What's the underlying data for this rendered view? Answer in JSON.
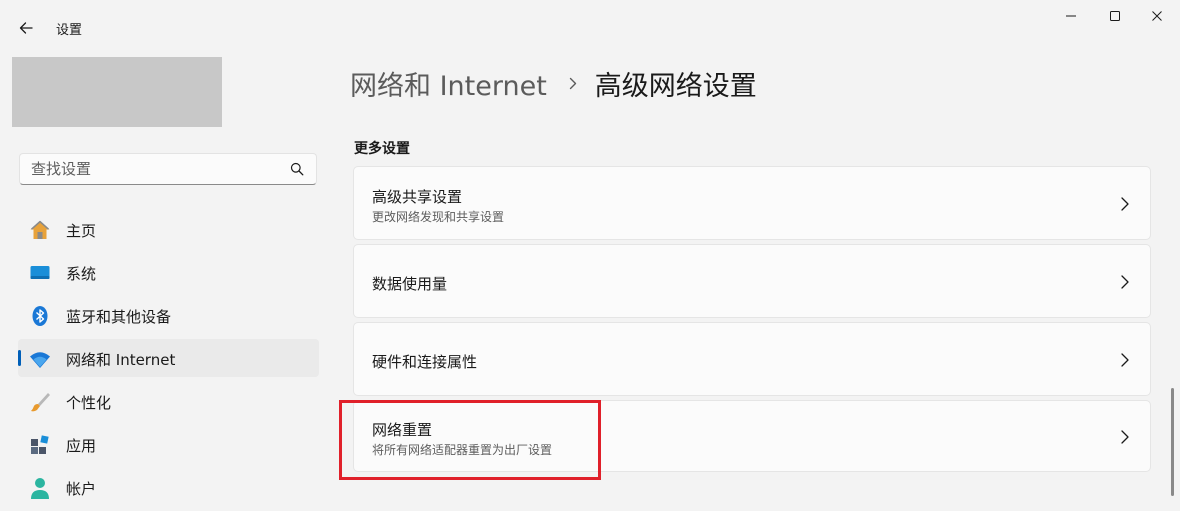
{
  "window": {
    "title": "设置"
  },
  "search": {
    "placeholder": "查找设置"
  },
  "sidebar": {
    "items": [
      {
        "label": "主页",
        "icon": "home-icon"
      },
      {
        "label": "系统",
        "icon": "system-icon"
      },
      {
        "label": "蓝牙和其他设备",
        "icon": "bluetooth-icon"
      },
      {
        "label": "网络和 Internet",
        "icon": "wifi-icon",
        "selected": true
      },
      {
        "label": "个性化",
        "icon": "brush-icon"
      },
      {
        "label": "应用",
        "icon": "apps-icon"
      },
      {
        "label": "帐户",
        "icon": "account-icon"
      }
    ]
  },
  "breadcrumb": {
    "parent": "网络和 Internet",
    "current": "高级网络设置"
  },
  "main": {
    "section_label": "更多设置",
    "cards": [
      {
        "title": "高级共享设置",
        "description": "更改网络发现和共享设置"
      },
      {
        "title": "数据使用量"
      },
      {
        "title": "硬件和连接属性"
      },
      {
        "title": "网络重置",
        "description": "将所有网络适配器重置为出厂设置",
        "highlighted": true
      }
    ]
  },
  "colors": {
    "accent": "#005fb8",
    "highlight": "#e0202a",
    "background": "#f3f3f3",
    "card": "#fbfbfb"
  }
}
